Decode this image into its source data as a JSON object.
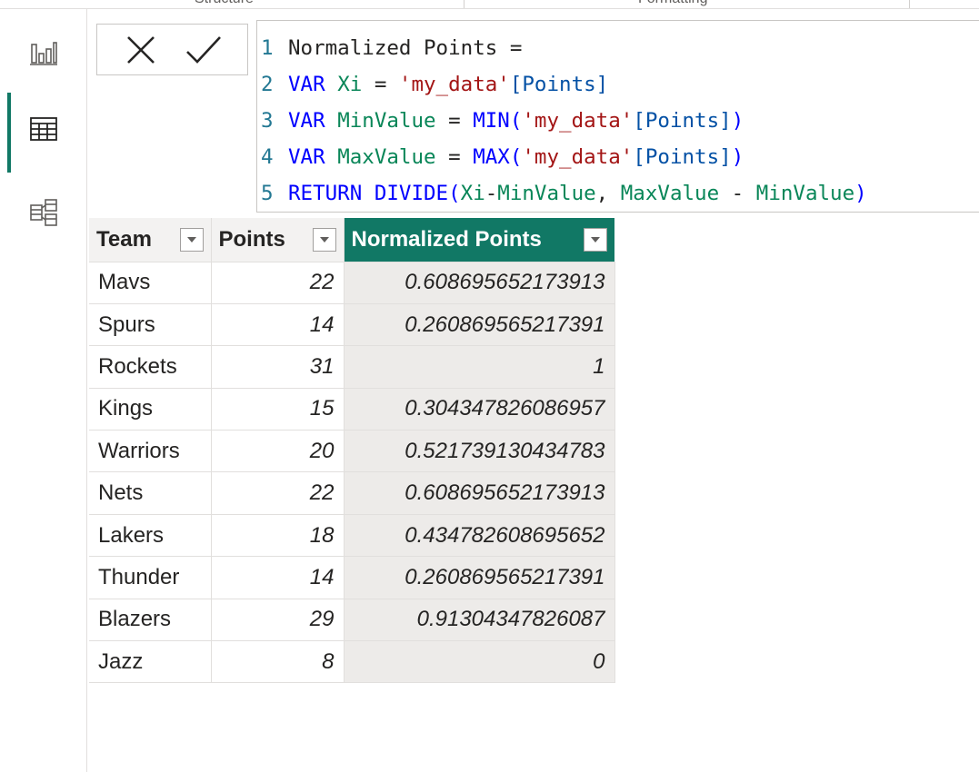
{
  "ribbon": {
    "group_1": "Structure",
    "group_2": "Formatting"
  },
  "rail": {
    "report_view": "Report view",
    "data_view": "Data view",
    "model_view": "Model view"
  },
  "formula": {
    "cancel_label": "Cancel",
    "commit_label": "Commit",
    "lines": [
      {
        "num": "1",
        "text": "Normalized Points ="
      },
      {
        "num": "2",
        "kw": "VAR ",
        "var": "Xi",
        "eq": " = ",
        "table": "'my_data'",
        "col": "[Points]"
      },
      {
        "num": "3",
        "kw": "VAR ",
        "var": "MinValue",
        "eq": " = ",
        "fn": "MIN(",
        "table": "'my_data'",
        "col": "[Points]",
        "close": ")"
      },
      {
        "num": "4",
        "kw": "VAR ",
        "var": "MaxValue",
        "eq": " = ",
        "fn": "MAX(",
        "table": "'my_data'",
        "col": "[Points]",
        "close": ")"
      },
      {
        "num": "5",
        "kw": "RETURN ",
        "fn": "DIVIDE(",
        "a": "Xi",
        "minus1": "-",
        "b": "MinValue",
        "comma": ", ",
        "c": "MaxValue",
        "minus2": " - ",
        "d": "MinValue",
        "close": ")"
      }
    ]
  },
  "table": {
    "headers": [
      "Team",
      "Points",
      "Normalized Points"
    ],
    "rows": [
      {
        "team": "Mavs",
        "points": "22",
        "normalized": "0.608695652173913"
      },
      {
        "team": "Spurs",
        "points": "14",
        "normalized": "0.260869565217391"
      },
      {
        "team": "Rockets",
        "points": "31",
        "normalized": "1"
      },
      {
        "team": "Kings",
        "points": "15",
        "normalized": "0.304347826086957"
      },
      {
        "team": "Warriors",
        "points": "20",
        "normalized": "0.521739130434783"
      },
      {
        "team": "Nets",
        "points": "22",
        "normalized": "0.608695652173913"
      },
      {
        "team": "Lakers",
        "points": "18",
        "normalized": "0.434782608695652"
      },
      {
        "team": "Thunder",
        "points": "14",
        "normalized": "0.260869565217391"
      },
      {
        "team": "Blazers",
        "points": "29",
        "normalized": "0.91304347826087"
      },
      {
        "team": "Jazz",
        "points": "8",
        "normalized": "0"
      }
    ]
  },
  "colors": {
    "accent": "#117865",
    "header_bg": "#f3f2f1",
    "calc_bg": "#edebe9"
  }
}
